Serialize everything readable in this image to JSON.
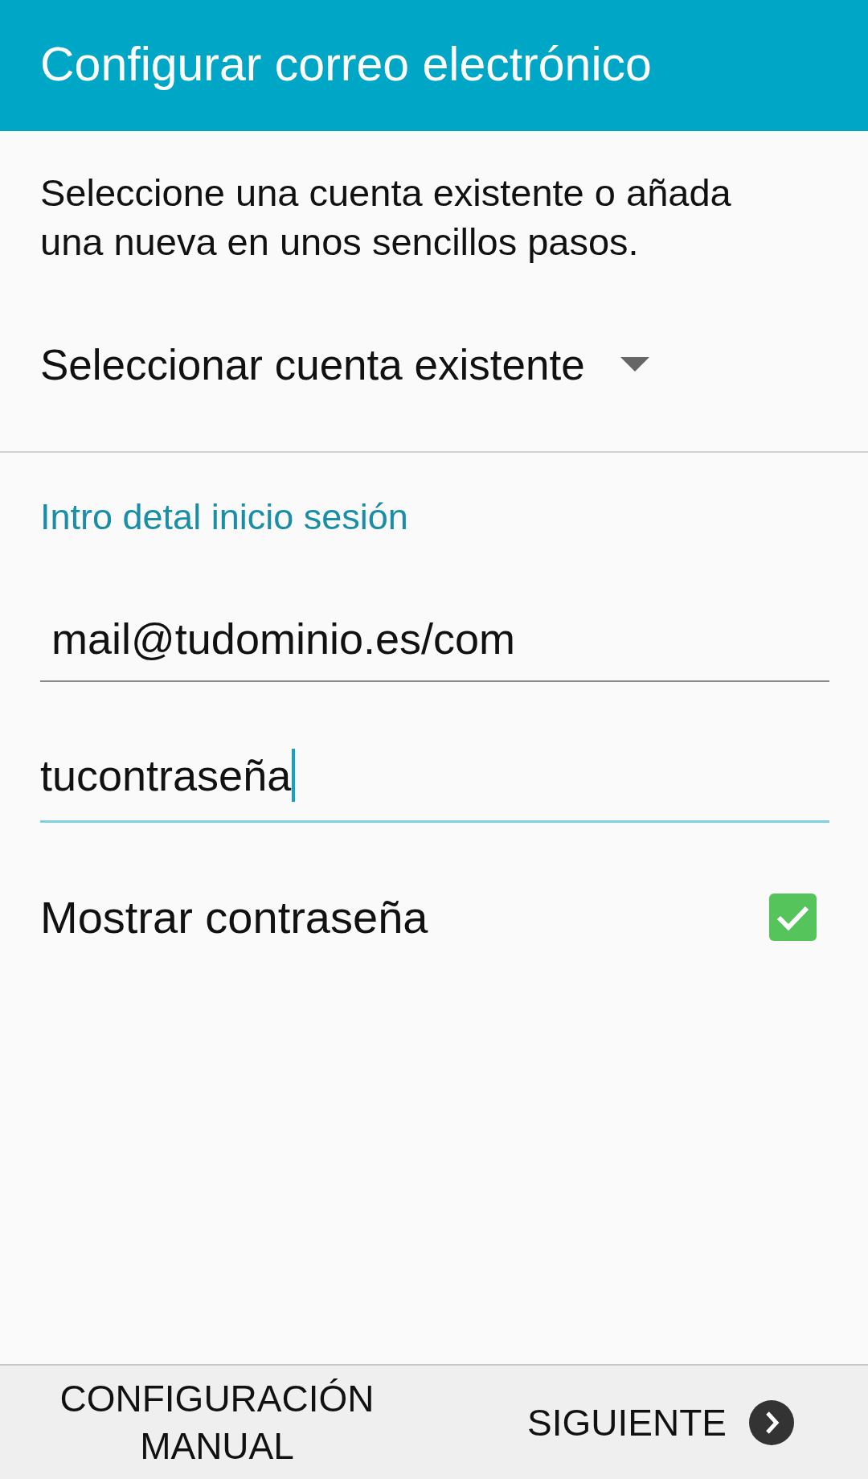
{
  "app_bar": {
    "title": "Configurar correo electrónico"
  },
  "intro": "Seleccione una cuenta existente o añada una nueva en unos sencillos pasos.",
  "account_select": {
    "value": "Seleccionar cuenta existente"
  },
  "login_section": {
    "heading": "Intro detal inicio sesión",
    "fields": [
      {
        "kind": "email",
        "value": "mail@tudominio.es/com",
        "focused": false
      },
      {
        "kind": "password",
        "value": "tucontraseña",
        "focused": true
      }
    ]
  },
  "show_password": {
    "label": "Mostrar contraseña",
    "checked": true
  },
  "bottom_bar": {
    "buttons": [
      {
        "kind": "text",
        "label": "CONFIGURACIÓN MANUAL"
      },
      {
        "kind": "next",
        "label": "SIGUIENTE"
      }
    ]
  }
}
